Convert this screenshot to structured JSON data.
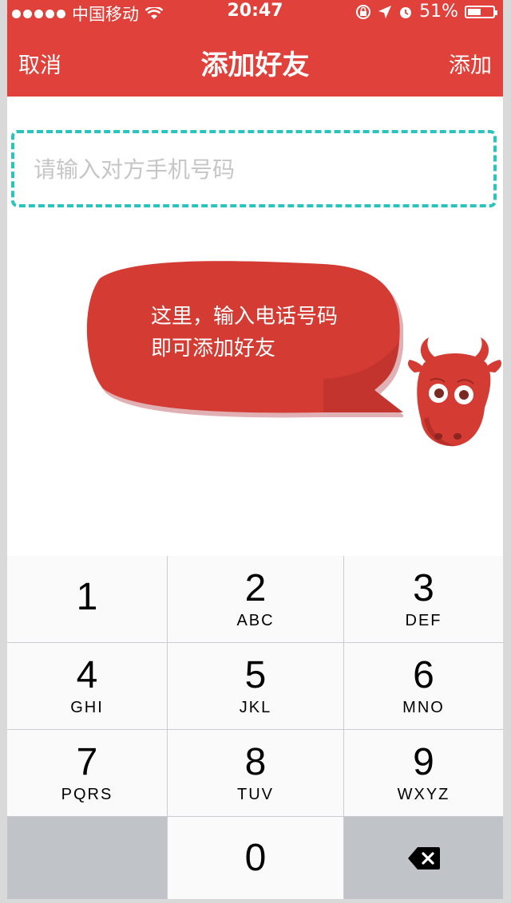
{
  "status_bar": {
    "carrier": "中国移动",
    "time": "20:47",
    "battery": "51%",
    "battery_level": 0.51
  },
  "nav": {
    "cancel_label": "取消",
    "title": "添加好友",
    "add_label": "添加"
  },
  "phone_input": {
    "value": "",
    "placeholder": "请输入对方手机号码"
  },
  "tip_bubble": {
    "line1": "这里，输入电话号码",
    "line2": "即可添加好友"
  },
  "keypad": {
    "keys": [
      {
        "num": "1",
        "letters": ""
      },
      {
        "num": "2",
        "letters": "ABC"
      },
      {
        "num": "3",
        "letters": "DEF"
      },
      {
        "num": "4",
        "letters": "GHI"
      },
      {
        "num": "5",
        "letters": "JKL"
      },
      {
        "num": "6",
        "letters": "MNO"
      },
      {
        "num": "7",
        "letters": "PQRS"
      },
      {
        "num": "8",
        "letters": "TUV"
      },
      {
        "num": "9",
        "letters": "WXYZ"
      },
      {
        "num": "0",
        "letters": ""
      }
    ]
  },
  "colors": {
    "brand_red": "#e0423b",
    "input_border": "#2ac3bd"
  }
}
